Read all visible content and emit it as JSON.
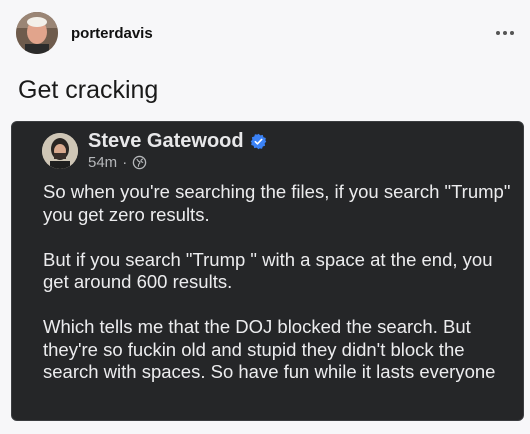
{
  "post": {
    "username": "porterdavis",
    "caption": "Get cracking",
    "more_icon": "more-horizontal-icon"
  },
  "embed": {
    "author": "Steve Gatewood",
    "time": "54m",
    "separator": "·",
    "verified_icon": "verified-badge-icon",
    "visibility_icon": "globe-icon",
    "colors": {
      "background": "#252628",
      "verified": "#3b82f6"
    },
    "paragraphs": [
      "So when you're searching the files, if you search \"Trump\" you get zero results.",
      "But if you search \"Trump \" with a space at the end, you get around 600 results.",
      "Which tells me that the DOJ blocked the search. But they're so fuckin old and stupid they didn't block the search with spaces. So have fun while it lasts everyone"
    ]
  }
}
